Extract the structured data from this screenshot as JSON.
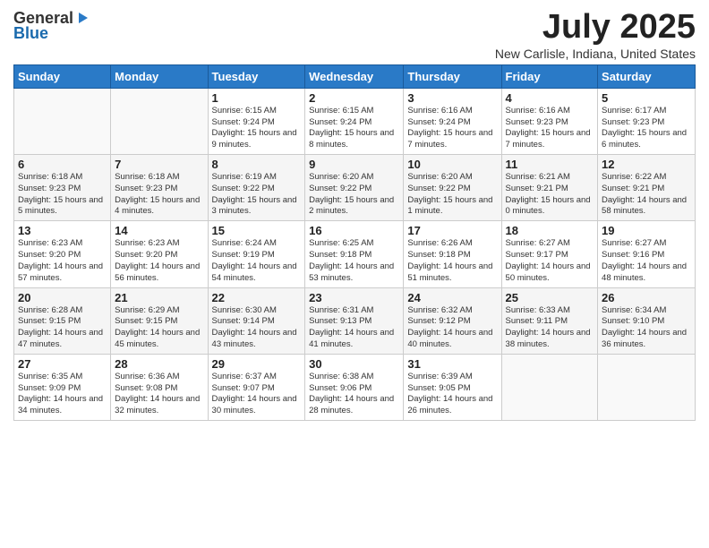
{
  "header": {
    "logo_general": "General",
    "logo_blue": "Blue",
    "month_title": "July 2025",
    "location": "New Carlisle, Indiana, United States"
  },
  "days_of_week": [
    "Sunday",
    "Monday",
    "Tuesday",
    "Wednesday",
    "Thursday",
    "Friday",
    "Saturday"
  ],
  "weeks": [
    [
      {
        "day": "",
        "sunrise": "",
        "sunset": "",
        "daylight": ""
      },
      {
        "day": "",
        "sunrise": "",
        "sunset": "",
        "daylight": ""
      },
      {
        "day": "1",
        "sunrise": "Sunrise: 6:15 AM",
        "sunset": "Sunset: 9:24 PM",
        "daylight": "Daylight: 15 hours and 9 minutes."
      },
      {
        "day": "2",
        "sunrise": "Sunrise: 6:15 AM",
        "sunset": "Sunset: 9:24 PM",
        "daylight": "Daylight: 15 hours and 8 minutes."
      },
      {
        "day": "3",
        "sunrise": "Sunrise: 6:16 AM",
        "sunset": "Sunset: 9:24 PM",
        "daylight": "Daylight: 15 hours and 7 minutes."
      },
      {
        "day": "4",
        "sunrise": "Sunrise: 6:16 AM",
        "sunset": "Sunset: 9:23 PM",
        "daylight": "Daylight: 15 hours and 7 minutes."
      },
      {
        "day": "5",
        "sunrise": "Sunrise: 6:17 AM",
        "sunset": "Sunset: 9:23 PM",
        "daylight": "Daylight: 15 hours and 6 minutes."
      }
    ],
    [
      {
        "day": "6",
        "sunrise": "Sunrise: 6:18 AM",
        "sunset": "Sunset: 9:23 PM",
        "daylight": "Daylight: 15 hours and 5 minutes."
      },
      {
        "day": "7",
        "sunrise": "Sunrise: 6:18 AM",
        "sunset": "Sunset: 9:23 PM",
        "daylight": "Daylight: 15 hours and 4 minutes."
      },
      {
        "day": "8",
        "sunrise": "Sunrise: 6:19 AM",
        "sunset": "Sunset: 9:22 PM",
        "daylight": "Daylight: 15 hours and 3 minutes."
      },
      {
        "day": "9",
        "sunrise": "Sunrise: 6:20 AM",
        "sunset": "Sunset: 9:22 PM",
        "daylight": "Daylight: 15 hours and 2 minutes."
      },
      {
        "day": "10",
        "sunrise": "Sunrise: 6:20 AM",
        "sunset": "Sunset: 9:22 PM",
        "daylight": "Daylight: 15 hours and 1 minute."
      },
      {
        "day": "11",
        "sunrise": "Sunrise: 6:21 AM",
        "sunset": "Sunset: 9:21 PM",
        "daylight": "Daylight: 15 hours and 0 minutes."
      },
      {
        "day": "12",
        "sunrise": "Sunrise: 6:22 AM",
        "sunset": "Sunset: 9:21 PM",
        "daylight": "Daylight: 14 hours and 58 minutes."
      }
    ],
    [
      {
        "day": "13",
        "sunrise": "Sunrise: 6:23 AM",
        "sunset": "Sunset: 9:20 PM",
        "daylight": "Daylight: 14 hours and 57 minutes."
      },
      {
        "day": "14",
        "sunrise": "Sunrise: 6:23 AM",
        "sunset": "Sunset: 9:20 PM",
        "daylight": "Daylight: 14 hours and 56 minutes."
      },
      {
        "day": "15",
        "sunrise": "Sunrise: 6:24 AM",
        "sunset": "Sunset: 9:19 PM",
        "daylight": "Daylight: 14 hours and 54 minutes."
      },
      {
        "day": "16",
        "sunrise": "Sunrise: 6:25 AM",
        "sunset": "Sunset: 9:18 PM",
        "daylight": "Daylight: 14 hours and 53 minutes."
      },
      {
        "day": "17",
        "sunrise": "Sunrise: 6:26 AM",
        "sunset": "Sunset: 9:18 PM",
        "daylight": "Daylight: 14 hours and 51 minutes."
      },
      {
        "day": "18",
        "sunrise": "Sunrise: 6:27 AM",
        "sunset": "Sunset: 9:17 PM",
        "daylight": "Daylight: 14 hours and 50 minutes."
      },
      {
        "day": "19",
        "sunrise": "Sunrise: 6:27 AM",
        "sunset": "Sunset: 9:16 PM",
        "daylight": "Daylight: 14 hours and 48 minutes."
      }
    ],
    [
      {
        "day": "20",
        "sunrise": "Sunrise: 6:28 AM",
        "sunset": "Sunset: 9:15 PM",
        "daylight": "Daylight: 14 hours and 47 minutes."
      },
      {
        "day": "21",
        "sunrise": "Sunrise: 6:29 AM",
        "sunset": "Sunset: 9:15 PM",
        "daylight": "Daylight: 14 hours and 45 minutes."
      },
      {
        "day": "22",
        "sunrise": "Sunrise: 6:30 AM",
        "sunset": "Sunset: 9:14 PM",
        "daylight": "Daylight: 14 hours and 43 minutes."
      },
      {
        "day": "23",
        "sunrise": "Sunrise: 6:31 AM",
        "sunset": "Sunset: 9:13 PM",
        "daylight": "Daylight: 14 hours and 41 minutes."
      },
      {
        "day": "24",
        "sunrise": "Sunrise: 6:32 AM",
        "sunset": "Sunset: 9:12 PM",
        "daylight": "Daylight: 14 hours and 40 minutes."
      },
      {
        "day": "25",
        "sunrise": "Sunrise: 6:33 AM",
        "sunset": "Sunset: 9:11 PM",
        "daylight": "Daylight: 14 hours and 38 minutes."
      },
      {
        "day": "26",
        "sunrise": "Sunrise: 6:34 AM",
        "sunset": "Sunset: 9:10 PM",
        "daylight": "Daylight: 14 hours and 36 minutes."
      }
    ],
    [
      {
        "day": "27",
        "sunrise": "Sunrise: 6:35 AM",
        "sunset": "Sunset: 9:09 PM",
        "daylight": "Daylight: 14 hours and 34 minutes."
      },
      {
        "day": "28",
        "sunrise": "Sunrise: 6:36 AM",
        "sunset": "Sunset: 9:08 PM",
        "daylight": "Daylight: 14 hours and 32 minutes."
      },
      {
        "day": "29",
        "sunrise": "Sunrise: 6:37 AM",
        "sunset": "Sunset: 9:07 PM",
        "daylight": "Daylight: 14 hours and 30 minutes."
      },
      {
        "day": "30",
        "sunrise": "Sunrise: 6:38 AM",
        "sunset": "Sunset: 9:06 PM",
        "daylight": "Daylight: 14 hours and 28 minutes."
      },
      {
        "day": "31",
        "sunrise": "Sunrise: 6:39 AM",
        "sunset": "Sunset: 9:05 PM",
        "daylight": "Daylight: 14 hours and 26 minutes."
      },
      {
        "day": "",
        "sunrise": "",
        "sunset": "",
        "daylight": ""
      },
      {
        "day": "",
        "sunrise": "",
        "sunset": "",
        "daylight": ""
      }
    ]
  ]
}
